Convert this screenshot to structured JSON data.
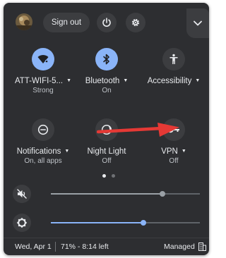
{
  "header": {
    "sign_out_label": "Sign out",
    "icons": [
      "avatar",
      "power-icon",
      "gear-icon",
      "chevron-down-icon"
    ]
  },
  "tiles": [
    {
      "label": "ATT-WIFI-5...",
      "sub": "Strong",
      "icon": "wifi-icon",
      "state": "on",
      "has_menu": true
    },
    {
      "label": "Bluetooth",
      "sub": "On",
      "icon": "bluetooth-icon",
      "state": "on",
      "has_menu": true
    },
    {
      "label": "Accessibility",
      "sub": "",
      "icon": "accessibility-icon",
      "state": "off",
      "has_menu": true
    },
    {
      "label": "Notifications",
      "sub": "On, all apps",
      "icon": "notifications-icon",
      "state": "off",
      "has_menu": true
    },
    {
      "label": "Night Light",
      "sub": "Off",
      "icon": "night-light-icon",
      "state": "off",
      "has_menu": false
    },
    {
      "label": "VPN",
      "sub": "Off",
      "icon": "vpn-key-icon",
      "state": "off",
      "has_menu": true
    }
  ],
  "pager": {
    "pages": 2,
    "current": 1
  },
  "sliders": {
    "volume": {
      "icon": "volume-muted-icon",
      "level": 0.75,
      "color": "#9aa0a6"
    },
    "brightness": {
      "icon": "brightness-icon",
      "level": 0.62,
      "color": "#8ab4f8"
    }
  },
  "footer": {
    "date": "Wed, Apr 1",
    "battery": "71% - 8:14 left",
    "managed": "Managed",
    "managed_icon": "managed-building-icon"
  },
  "colors": {
    "panel_bg": "#2d2e31",
    "button_bg": "#3c3d40",
    "accent": "#8ab4f8",
    "annotation_arrow": "#e53935"
  }
}
